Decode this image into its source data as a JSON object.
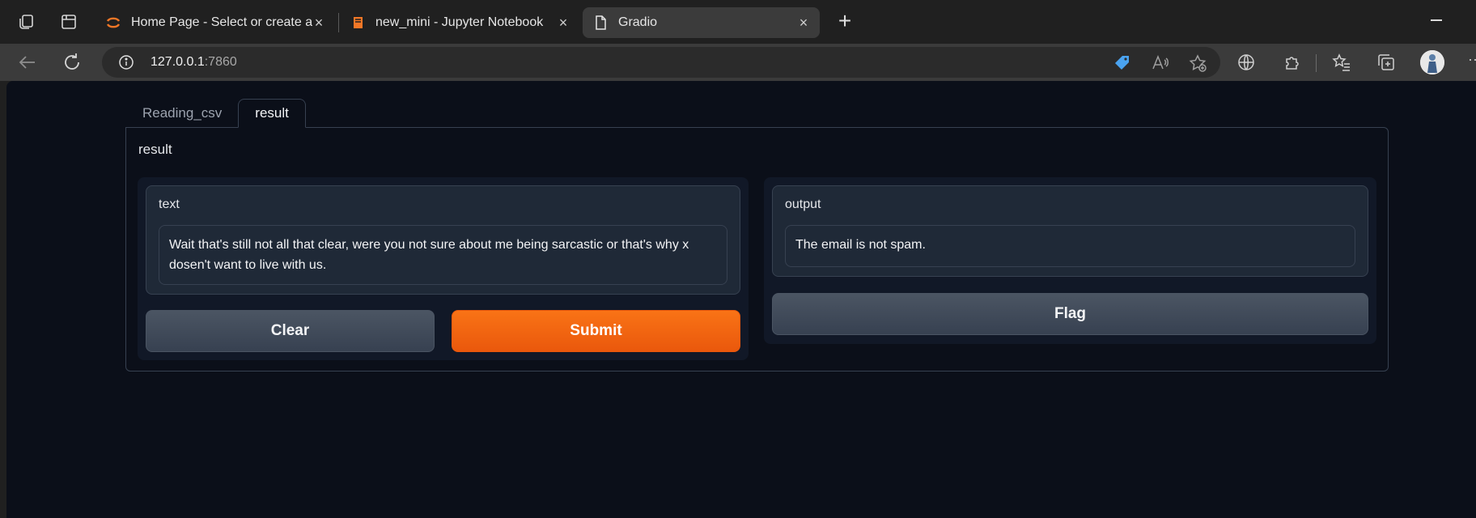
{
  "browser": {
    "tabs": [
      {
        "title": "Home Page - Select or create a n",
        "icon": "jupyter-spinner-icon",
        "active": false
      },
      {
        "title": "new_mini - Jupyter Notebook",
        "icon": "notebook-icon",
        "active": false
      },
      {
        "title": "Gradio",
        "icon": "page-icon",
        "active": true
      }
    ],
    "address": {
      "host": "127.0.0.1",
      "port": ":7860"
    }
  },
  "app": {
    "tabs": [
      {
        "label": "Reading_csv",
        "active": false
      },
      {
        "label": "result",
        "active": true
      }
    ],
    "panel_title": "result",
    "input": {
      "label": "text",
      "value": "Wait that's still not all that clear, were you not sure about me being sarcastic or that's why x dosen't want to live with us."
    },
    "output": {
      "label": "output",
      "value": "The email is not spam."
    },
    "buttons": {
      "clear": "Clear",
      "submit": "Submit",
      "flag": "Flag"
    }
  },
  "colors": {
    "accent": "#f97316",
    "background": "#0b0f19",
    "block": "#1f2937"
  }
}
